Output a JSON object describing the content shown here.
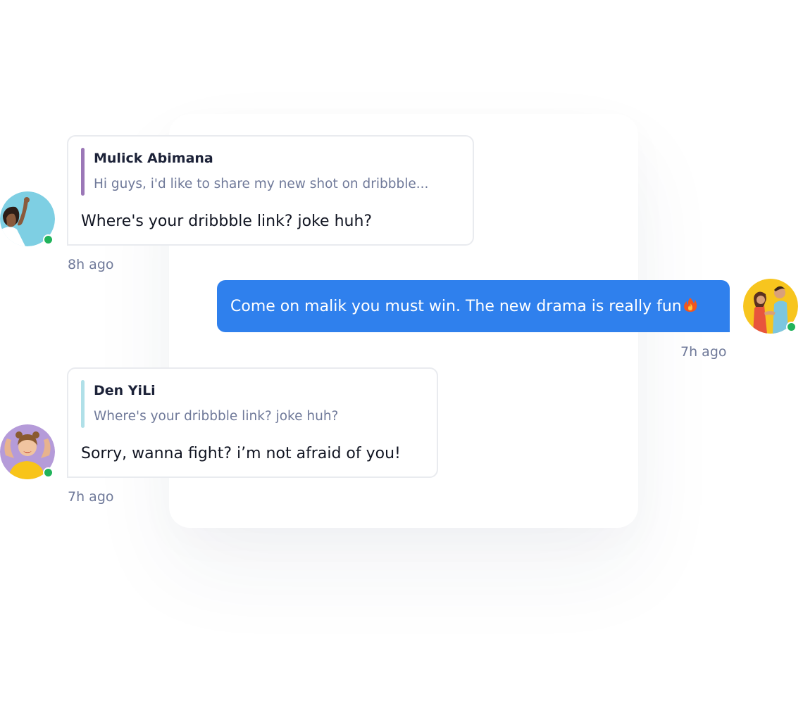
{
  "messages": [
    {
      "sender": "Mulick Abimana",
      "quoted_text": "Hi guys, i'd like to share my new shot on dribbble...",
      "text": "Where's your dribbble link? joke huh?",
      "time": "8h ago",
      "status": "online",
      "accent_color": "#9b77b7"
    },
    {
      "text": "Come on malik you must win. The new drama is really fun",
      "emoji": "flame-icon",
      "time": "7h ago",
      "status": "online",
      "bubble_color": "#2f80ed"
    },
    {
      "sender": "Den YiLi",
      "quoted_text": "Where's your dribbble link? joke huh?",
      "text": "Sorry, wanna fight? i’m not afraid of you!",
      "time": "7h ago",
      "status": "online",
      "accent_color": "#b0e0e8"
    }
  ],
  "colors": {
    "online": "#21b35b",
    "muted_text": "#6f7999",
    "primary": "#2f80ed"
  }
}
